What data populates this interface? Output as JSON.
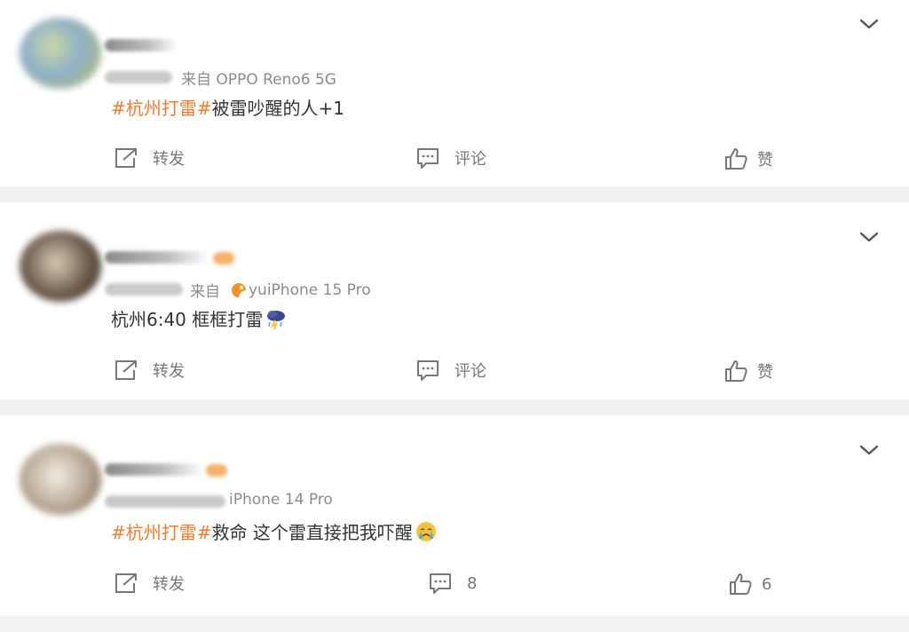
{
  "posts": [
    {
      "meta_text": "来自 OPPO Reno6 5G",
      "content_tag": "#杭州打雷#",
      "content_text": "被雷吵醒的人+1",
      "actions": {
        "repost": "转发",
        "comment": "评论",
        "like": "赞"
      }
    },
    {
      "meta_text": "来自",
      "meta_source": "yuiPhone 15 Pro",
      "content_tag": "",
      "content_text": "杭州6:40 框框打雷",
      "actions": {
        "repost": "转发",
        "comment": "评论",
        "like": "赞"
      }
    },
    {
      "meta_text": "iPhone 14 Pro",
      "content_tag": "#杭州打雷#",
      "content_text": "救命 这个雷直接把我吓醒",
      "actions": {
        "repost": "转发",
        "comment": "8",
        "like": "6"
      }
    }
  ],
  "icons": {
    "expand": "chevron-down-icon",
    "repost": "repost-icon",
    "comment": "comment-icon",
    "like": "thumbs-up-icon",
    "weather_emoji": "thunderstorm-icon",
    "crying_emoji": "crying-face-icon"
  },
  "colors": {
    "tag": "#f07c2e",
    "text": "#333333",
    "meta": "#8c8c8c",
    "divider": "#f1f1f1"
  }
}
